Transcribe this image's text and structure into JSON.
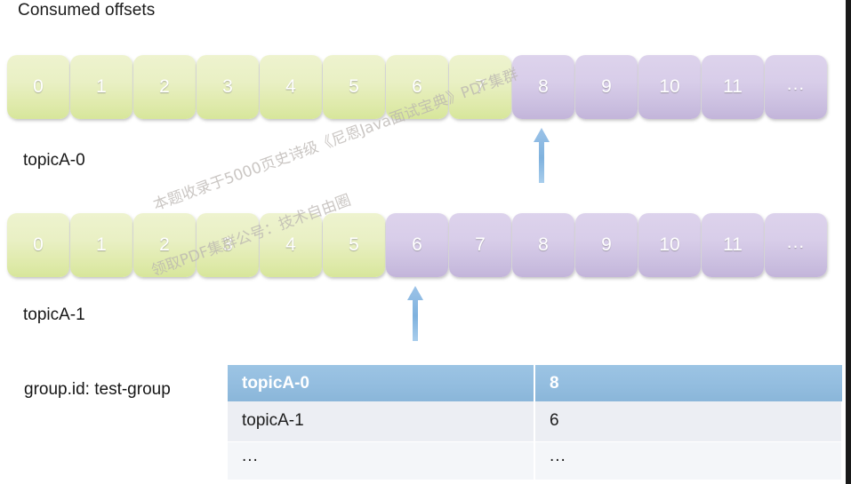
{
  "title": "Consumed offsets",
  "colors": {
    "consumed": "#dfeaab",
    "pending": "#cbbfe0",
    "table_header": "#93bddf",
    "arrow": "#7fb2de",
    "text": "#1c1c1c"
  },
  "partitions": [
    {
      "label": "topicA-0",
      "arrow_target_index": 8,
      "cells": [
        {
          "text": "0",
          "state": "consumed"
        },
        {
          "text": "1",
          "state": "consumed"
        },
        {
          "text": "2",
          "state": "consumed"
        },
        {
          "text": "3",
          "state": "consumed"
        },
        {
          "text": "4",
          "state": "consumed"
        },
        {
          "text": "5",
          "state": "consumed"
        },
        {
          "text": "6",
          "state": "consumed"
        },
        {
          "text": "7",
          "state": "consumed"
        },
        {
          "text": "8",
          "state": "pending"
        },
        {
          "text": "9",
          "state": "pending"
        },
        {
          "text": "10",
          "state": "pending"
        },
        {
          "text": "11",
          "state": "pending"
        },
        {
          "text": "...",
          "state": "pending"
        }
      ]
    },
    {
      "label": "topicA-1",
      "arrow_target_index": 6,
      "cells": [
        {
          "text": "0",
          "state": "consumed"
        },
        {
          "text": "1",
          "state": "consumed"
        },
        {
          "text": "2",
          "state": "consumed"
        },
        {
          "text": "3",
          "state": "consumed"
        },
        {
          "text": "4",
          "state": "consumed"
        },
        {
          "text": "5",
          "state": "consumed"
        },
        {
          "text": "6",
          "state": "pending"
        },
        {
          "text": "7",
          "state": "pending"
        },
        {
          "text": "8",
          "state": "pending"
        },
        {
          "text": "9",
          "state": "pending"
        },
        {
          "text": "10",
          "state": "pending"
        },
        {
          "text": "11",
          "state": "pending"
        },
        {
          "text": "...",
          "state": "pending"
        }
      ]
    }
  ],
  "group_label": "group.id: test-group",
  "offsets_table": {
    "header": [
      "topicA-0",
      "8"
    ],
    "rows": [
      [
        "topicA-1",
        "6"
      ],
      [
        "...",
        "..."
      ]
    ]
  },
  "watermark": {
    "line1": "本题收录于5000页史诗级《尼恩Java面试宝典》PDF集群",
    "line2": "领取PDF集群公号：技术自由圈"
  }
}
